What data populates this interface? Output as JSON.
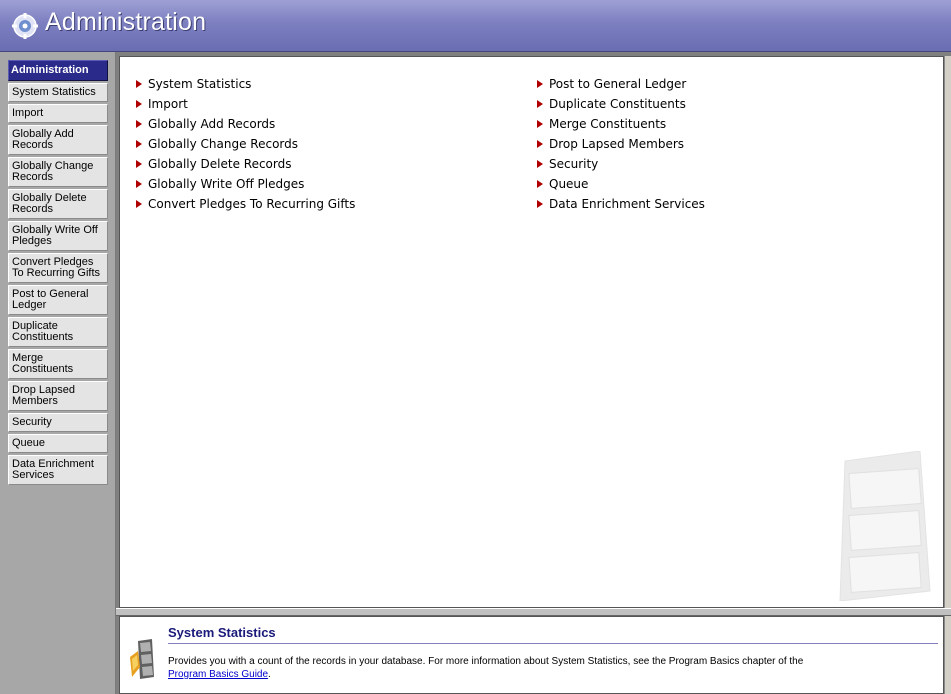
{
  "window": {
    "title": "Administration"
  },
  "nav": {
    "items": [
      {
        "label": "Administration",
        "active": true
      },
      {
        "label": "System Statistics"
      },
      {
        "label": "Import"
      },
      {
        "label": "Globally Add Records"
      },
      {
        "label": "Globally Change Records"
      },
      {
        "label": "Globally Delete Records"
      },
      {
        "label": "Globally Write Off Pledges"
      },
      {
        "label": "Convert Pledges To Recurring Gifts"
      },
      {
        "label": "Post to General Ledger"
      },
      {
        "label": "Duplicate Constituents"
      },
      {
        "label": "Merge Constituents"
      },
      {
        "label": "Drop Lapsed Members"
      },
      {
        "label": "Security"
      },
      {
        "label": "Queue"
      },
      {
        "label": "Data Enrichment Services"
      }
    ]
  },
  "main": {
    "links_left": [
      "System Statistics",
      "Import",
      "Globally Add Records",
      "Globally Change Records",
      "Globally Delete Records",
      "Globally Write Off Pledges",
      "Convert Pledges To Recurring Gifts"
    ],
    "links_right": [
      "Post to General Ledger",
      "Duplicate Constituents",
      "Merge Constituents",
      "Drop Lapsed Members",
      "Security",
      "Queue",
      "Data Enrichment Services"
    ],
    "bullet_color": "#b00000"
  },
  "info": {
    "title": "System Statistics",
    "text": "Provides you with a count of the records in your database. For more information about System Statistics, see the Program Basics chapter of the",
    "link_text": "Program Basics Guide",
    "link_suffix": "."
  },
  "colors": {
    "titlebar": "#7c7fc0",
    "nav_active": "#2a2a8a",
    "info_title": "#1a1a7a"
  }
}
